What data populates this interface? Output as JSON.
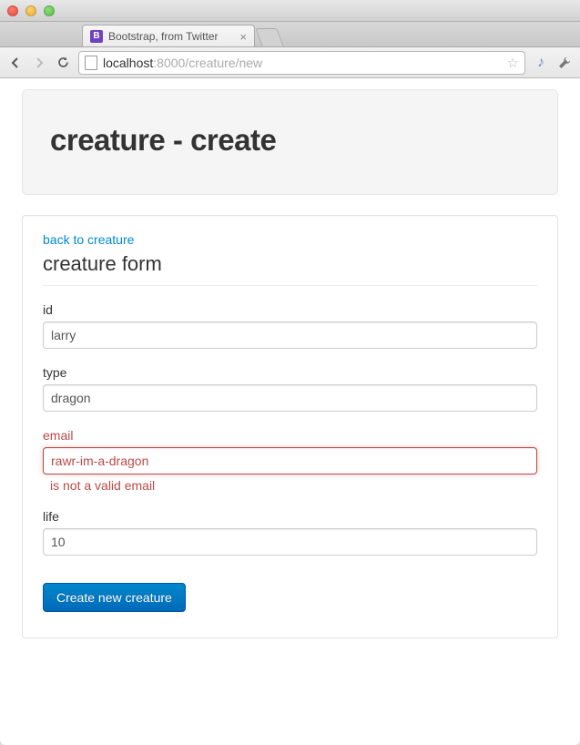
{
  "browser": {
    "tab_title": "Bootstrap, from Twitter",
    "favicon_letter": "B",
    "url_host": "localhost",
    "url_port_path": ":8000/creature/new"
  },
  "hero": {
    "title": "creature - create"
  },
  "nav": {
    "back_link": "back to creature"
  },
  "form": {
    "title": "creature form",
    "fields": {
      "id": {
        "label": "id",
        "value": "larry"
      },
      "type": {
        "label": "type",
        "value": "dragon"
      },
      "email": {
        "label": "email",
        "value": "rawr-im-a-dragon",
        "error": "is not a valid email"
      },
      "life": {
        "label": "life",
        "value": "10"
      }
    },
    "submit_label": "Create new creature"
  }
}
